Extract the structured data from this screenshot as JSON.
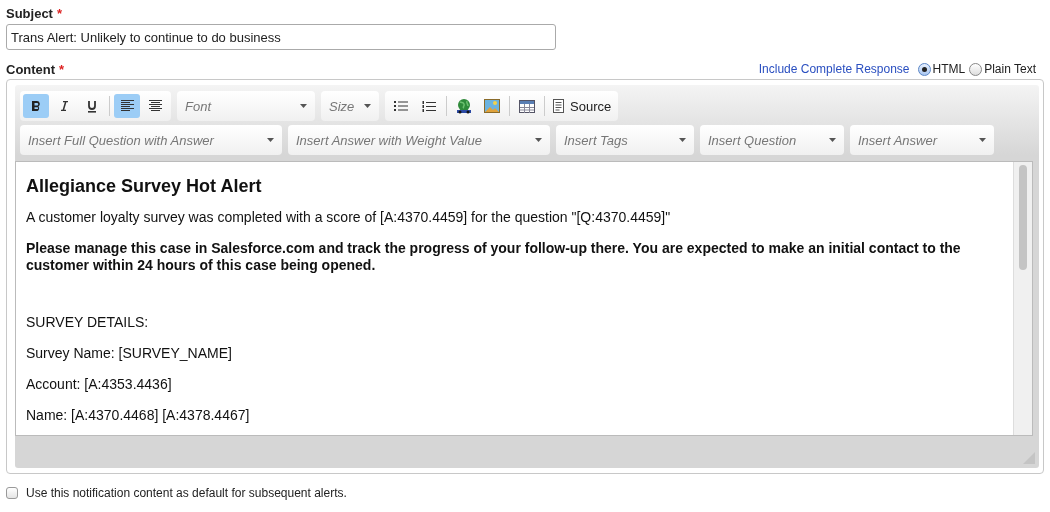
{
  "subject": {
    "label": "Subject",
    "required_mark": "*",
    "value": "Trans Alert: Unlikely to continue to do business"
  },
  "content": {
    "label": "Content",
    "required_mark": "*",
    "include_link": "Include Complete Response",
    "formats": [
      {
        "label": "HTML",
        "selected": true
      },
      {
        "label": "Plain Text",
        "selected": false
      }
    ]
  },
  "toolbar": {
    "format_buttons": [
      {
        "kind": "bold",
        "selected": true
      },
      {
        "kind": "italic",
        "selected": false
      },
      {
        "kind": "underline",
        "selected": false
      }
    ],
    "align_buttons": [
      {
        "kind": "left",
        "selected": true
      },
      {
        "kind": "center",
        "selected": false
      }
    ],
    "font_placeholder": "Font",
    "size_placeholder": "Size",
    "source_label": "Source",
    "insert_dropdowns": [
      "Insert Full Question with Answer",
      "Insert Answer with Weight Value",
      "Insert Tags",
      "Insert Question",
      "Insert Answer"
    ]
  },
  "body": {
    "heading": "Allegiance Survey Hot Alert",
    "paragraphs": [
      {
        "text": "A customer loyalty survey was completed with a score of [A:4370.4459] for the question \"[Q:4370.4459]\"",
        "bold": false
      },
      {
        "text": "Please manage this case in Salesforce.com and track the progress of your follow-up there. You are expected to make an initial contact to the customer within 24 hours of this case being opened.",
        "bold": true
      },
      {
        "text": "SURVEY DETAILS:",
        "bold": false
      },
      {
        "text": "Survey Name: [SURVEY_NAME]",
        "bold": false
      },
      {
        "text": "Account: [A:4353.4436]",
        "bold": false
      },
      {
        "text": "Name: [A:4370.4468] [A:4378.4467]",
        "bold": false
      }
    ]
  },
  "default_option": {
    "label": "Use this notification content as default for subsequent alerts.",
    "checked": false
  }
}
